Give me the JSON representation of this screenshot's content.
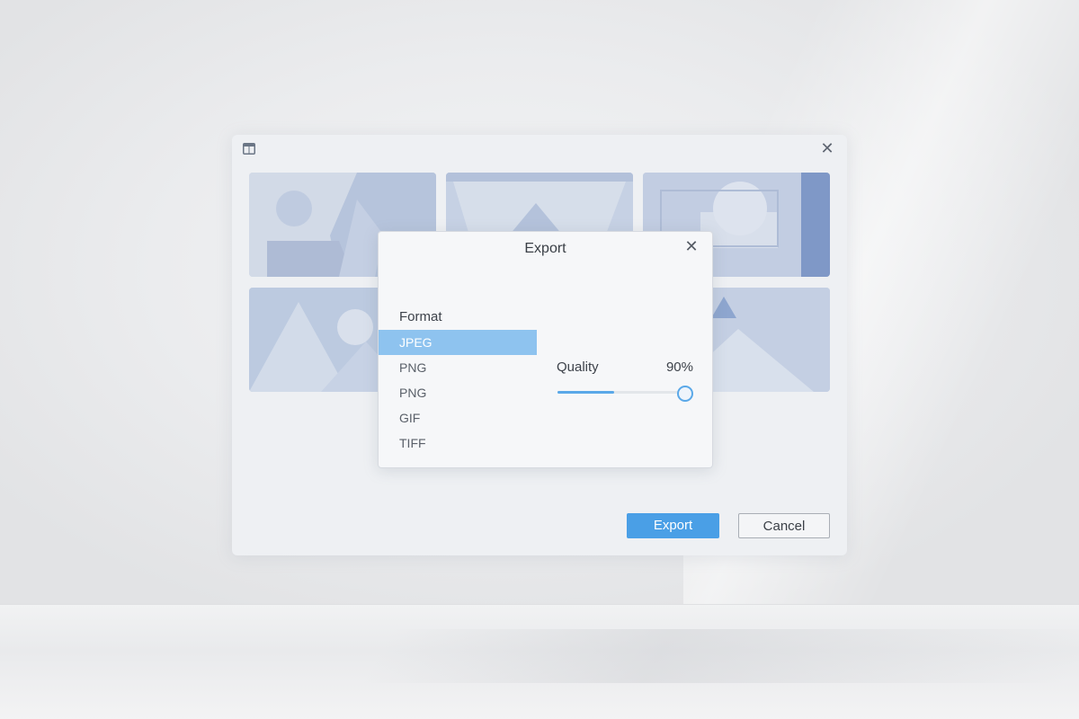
{
  "window": {
    "app_icon": "grid-app-icon",
    "close_label": "✕"
  },
  "actions": {
    "export_label": "Export",
    "cancel_label": "Cancel",
    "accent": "#4a9fe6"
  },
  "export_dialog": {
    "title": "Export",
    "close_label": "✕",
    "format_label": "Format",
    "formats": [
      "JPEG",
      "PNG",
      "PNG",
      "GIF",
      "TIFF"
    ],
    "selected_format": "JPEG",
    "quality_label": "Quality",
    "quality_value": "90%",
    "quality_slider_fraction": 0.9
  }
}
